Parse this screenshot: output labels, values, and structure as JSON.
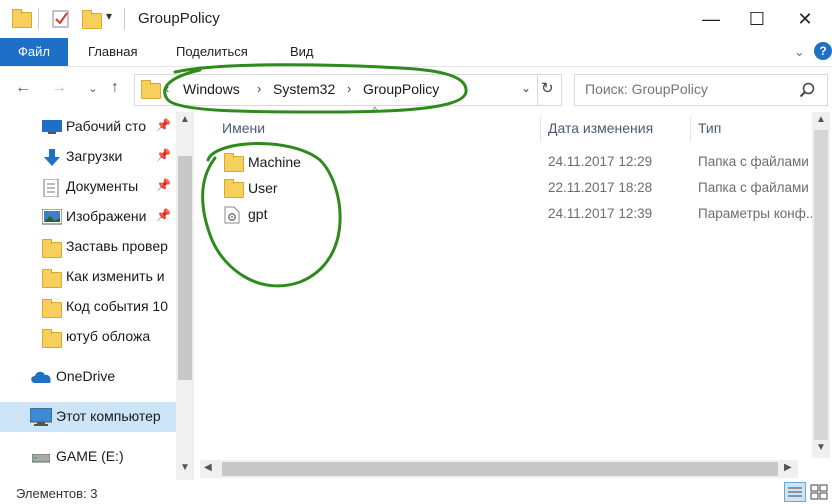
{
  "window": {
    "title": "GroupPolicy",
    "minimize_glyph": "—",
    "maximize_glyph": "☐",
    "close_glyph": "✕"
  },
  "ribbon": {
    "tabs": [
      "Файл",
      "Главная",
      "Поделиться",
      "Вид"
    ]
  },
  "address": {
    "crumbs": [
      "Windows",
      "System32",
      "GroupPolicy"
    ],
    "overflow_glyph": "‹"
  },
  "search": {
    "placeholder": "Поиск: GroupPolicy"
  },
  "sidebar": {
    "items": [
      {
        "label": "Рабочий сто",
        "icon": "desktop-icon",
        "pinned": true
      },
      {
        "label": "Загрузки",
        "icon": "download-icon",
        "pinned": true
      },
      {
        "label": "Документы",
        "icon": "documents-icon",
        "pinned": true
      },
      {
        "label": "Изображени",
        "icon": "pictures-icon",
        "pinned": true
      },
      {
        "label": "Заставь провер",
        "icon": "folder-icon",
        "pinned": false
      },
      {
        "label": "Как изменить и",
        "icon": "folder-icon",
        "pinned": false
      },
      {
        "label": "Код события 10",
        "icon": "folder-icon",
        "pinned": false
      },
      {
        "label": "ютуб обложа",
        "icon": "folder-icon",
        "pinned": false
      },
      {
        "label": "OneDrive",
        "icon": "onedrive-icon",
        "pinned": false
      },
      {
        "label": "Этот компьютер",
        "icon": "computer-icon",
        "pinned": false,
        "selected": true
      },
      {
        "label": "GAME (E:)",
        "icon": "drive-icon",
        "pinned": false
      }
    ]
  },
  "columns": {
    "name": "Имени",
    "date": "Дата изменения",
    "type": "Тип"
  },
  "files": [
    {
      "name": "Machine",
      "date": "24.11.2017 12:29",
      "type": "Папка с файлами",
      "icon": "folder-icon"
    },
    {
      "name": "User",
      "date": "22.11.2017 18:28",
      "type": "Папка с файлами",
      "icon": "folder-icon"
    },
    {
      "name": "gpt",
      "date": "24.11.2017 12:39",
      "type": "Параметры конф...",
      "icon": "settings-file-icon"
    }
  ],
  "status": {
    "count_text": "Элементов: 3"
  },
  "colors": {
    "accent": "#1e6fc6",
    "annotation": "#2f8a1e",
    "folder": "#f7cf5c"
  }
}
